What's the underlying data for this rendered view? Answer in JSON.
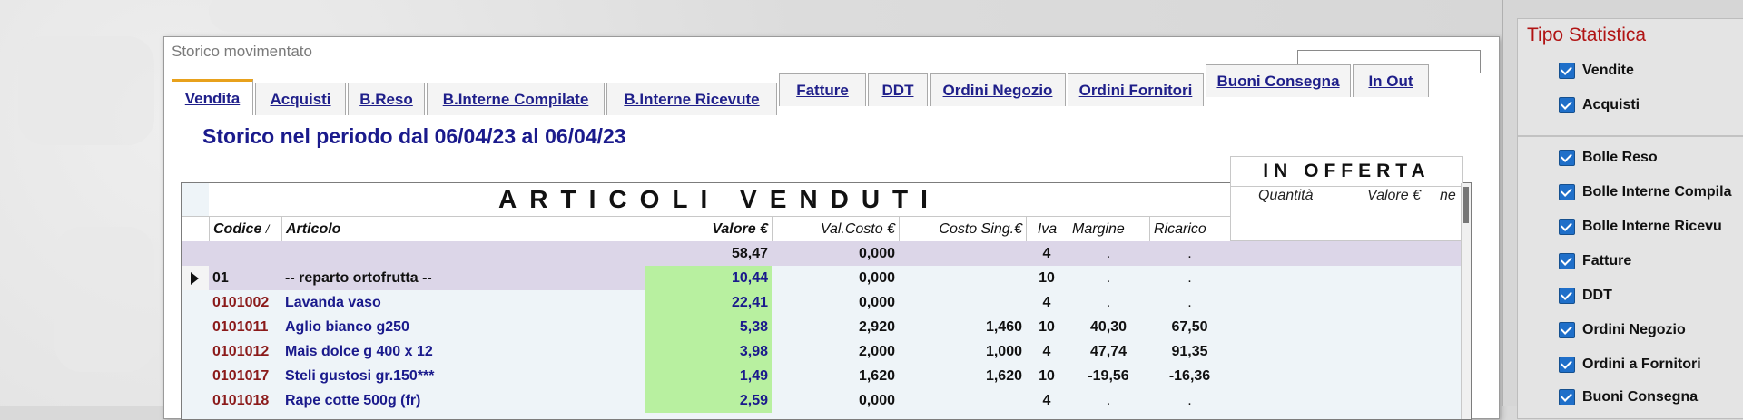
{
  "window": {
    "title": "Storico movimentato"
  },
  "tabs": [
    {
      "label": "Vendita",
      "active": true
    },
    {
      "label": "Acquisti"
    },
    {
      "label": "B.Reso"
    },
    {
      "label": "B.Interne Compilate"
    },
    {
      "label": "B.Interne Ricevute"
    },
    {
      "label": "Fatture"
    },
    {
      "label": "DDT"
    },
    {
      "label": "Ordini Negozio"
    },
    {
      "label": "Ordini Fornitori"
    },
    {
      "label": "Buoni Consegna"
    },
    {
      "label": "In Out"
    }
  ],
  "heading": "Storico nel periodo dal 06/04/23 al 06/04/23",
  "grid": {
    "band_title": "ARTICOLI VENDUTI",
    "offerta_title": "IN OFFERTA",
    "offerta_headers": {
      "quantita": "Quantità",
      "valore": "Valore €",
      "extra": "ne"
    },
    "headers": {
      "codice": "Codice",
      "sort_mark": "/",
      "articolo": "Articolo",
      "valore": "Valore €",
      "val_costo": "Val.Costo €",
      "costo_sing": "Costo Sing.€",
      "iva": "Iva",
      "margine": "Margine",
      "ricarico": "Ricarico"
    },
    "summary_row": {
      "iva": "4",
      "margine": ".",
      "ricarico": ".",
      "valore": "58,47",
      "val_costo": "0,000"
    },
    "rows": [
      {
        "codice": "01",
        "articolo": "-- reparto ortofrutta --",
        "valore": "10,44",
        "val_costo": "0,000",
        "costo_sing": "",
        "iva": "10",
        "margine": ".",
        "ricarico": ".",
        "selected": true
      },
      {
        "codice": "0101002",
        "articolo": "Lavanda vaso",
        "valore": "22,41",
        "val_costo": "0,000",
        "costo_sing": "",
        "iva": "4",
        "margine": ".",
        "ricarico": "."
      },
      {
        "codice": "0101011",
        "articolo": "Aglio bianco g250",
        "valore": "5,38",
        "val_costo": "2,920",
        "costo_sing": "1,460",
        "iva": "10",
        "margine": "40,30",
        "ricarico": "67,50"
      },
      {
        "codice": "0101012",
        "articolo": "Mais dolce g 400 x 12",
        "valore": "3,98",
        "val_costo": "2,000",
        "costo_sing": "1,000",
        "iva": "4",
        "margine": "47,74",
        "ricarico": "91,35"
      },
      {
        "codice": "0101017",
        "articolo": "Steli gustosi gr.150***",
        "valore": "1,49",
        "val_costo": "1,620",
        "costo_sing": "1,620",
        "iva": "10",
        "margine": "-19,56",
        "ricarico": "-16,36"
      },
      {
        "codice": "0101018",
        "articolo": "Rape cotte 500g (fr)",
        "valore": "2,59",
        "val_costo": "0,000",
        "costo_sing": "",
        "iva": "4",
        "margine": ".",
        "ricarico": "."
      }
    ]
  },
  "panel": {
    "title": "Tipo Statistica",
    "group1": [
      {
        "label": "Vendite",
        "checked": true
      },
      {
        "label": "Acquisti",
        "checked": true
      }
    ],
    "group2": [
      {
        "label": "Bolle Reso",
        "checked": true
      },
      {
        "label": "Bolle Interne Compila",
        "checked": true
      },
      {
        "label": "Bolle Interne Ricevu",
        "checked": true
      },
      {
        "label": "Fatture",
        "checked": true
      },
      {
        "label": "DDT",
        "checked": true
      },
      {
        "label": "Ordini Negozio",
        "checked": true
      },
      {
        "label": "Ordini a Fornitori",
        "checked": true
      },
      {
        "label": "Buoni Consegna",
        "checked": true
      }
    ]
  }
}
